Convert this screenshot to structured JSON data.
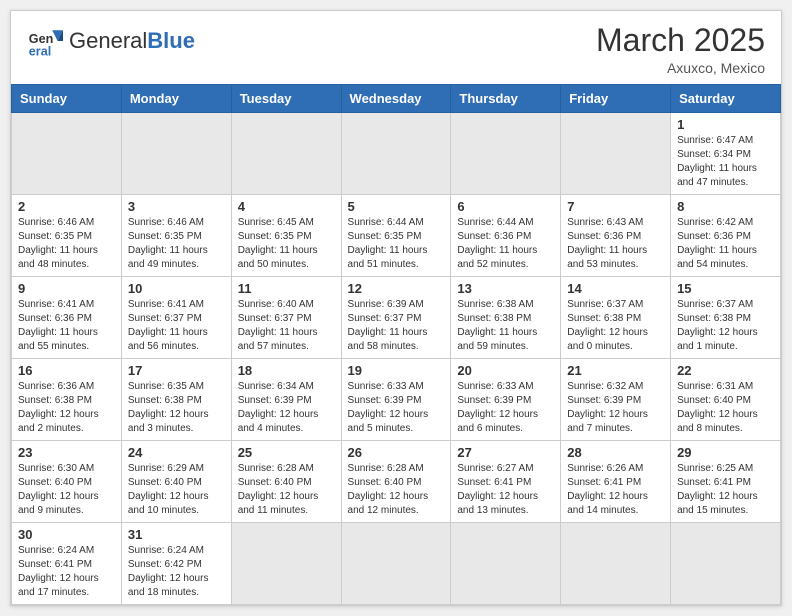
{
  "header": {
    "logo_general": "General",
    "logo_blue": "Blue",
    "month_year": "March 2025",
    "subtitle": "Axuxco, Mexico"
  },
  "days_of_week": [
    "Sunday",
    "Monday",
    "Tuesday",
    "Wednesday",
    "Thursday",
    "Friday",
    "Saturday"
  ],
  "weeks": [
    [
      {
        "day": "",
        "empty": true
      },
      {
        "day": "",
        "empty": true
      },
      {
        "day": "",
        "empty": true
      },
      {
        "day": "",
        "empty": true
      },
      {
        "day": "",
        "empty": true
      },
      {
        "day": "",
        "empty": true
      },
      {
        "day": "1",
        "sunrise": "6:47 AM",
        "sunset": "6:34 PM",
        "daylight": "11 hours and 47 minutes."
      }
    ],
    [
      {
        "day": "2",
        "sunrise": "6:46 AM",
        "sunset": "6:35 PM",
        "daylight": "11 hours and 48 minutes."
      },
      {
        "day": "3",
        "sunrise": "6:46 AM",
        "sunset": "6:35 PM",
        "daylight": "11 hours and 49 minutes."
      },
      {
        "day": "4",
        "sunrise": "6:45 AM",
        "sunset": "6:35 PM",
        "daylight": "11 hours and 50 minutes."
      },
      {
        "day": "5",
        "sunrise": "6:44 AM",
        "sunset": "6:35 PM",
        "daylight": "11 hours and 51 minutes."
      },
      {
        "day": "6",
        "sunrise": "6:44 AM",
        "sunset": "6:36 PM",
        "daylight": "11 hours and 52 minutes."
      },
      {
        "day": "7",
        "sunrise": "6:43 AM",
        "sunset": "6:36 PM",
        "daylight": "11 hours and 53 minutes."
      },
      {
        "day": "8",
        "sunrise": "6:42 AM",
        "sunset": "6:36 PM",
        "daylight": "11 hours and 54 minutes."
      }
    ],
    [
      {
        "day": "9",
        "sunrise": "6:41 AM",
        "sunset": "6:36 PM",
        "daylight": "11 hours and 55 minutes."
      },
      {
        "day": "10",
        "sunrise": "6:41 AM",
        "sunset": "6:37 PM",
        "daylight": "11 hours and 56 minutes."
      },
      {
        "day": "11",
        "sunrise": "6:40 AM",
        "sunset": "6:37 PM",
        "daylight": "11 hours and 57 minutes."
      },
      {
        "day": "12",
        "sunrise": "6:39 AM",
        "sunset": "6:37 PM",
        "daylight": "11 hours and 58 minutes."
      },
      {
        "day": "13",
        "sunrise": "6:38 AM",
        "sunset": "6:38 PM",
        "daylight": "11 hours and 59 minutes."
      },
      {
        "day": "14",
        "sunrise": "6:37 AM",
        "sunset": "6:38 PM",
        "daylight": "12 hours and 0 minutes."
      },
      {
        "day": "15",
        "sunrise": "6:37 AM",
        "sunset": "6:38 PM",
        "daylight": "12 hours and 1 minute."
      }
    ],
    [
      {
        "day": "16",
        "sunrise": "6:36 AM",
        "sunset": "6:38 PM",
        "daylight": "12 hours and 2 minutes."
      },
      {
        "day": "17",
        "sunrise": "6:35 AM",
        "sunset": "6:38 PM",
        "daylight": "12 hours and 3 minutes."
      },
      {
        "day": "18",
        "sunrise": "6:34 AM",
        "sunset": "6:39 PM",
        "daylight": "12 hours and 4 minutes."
      },
      {
        "day": "19",
        "sunrise": "6:33 AM",
        "sunset": "6:39 PM",
        "daylight": "12 hours and 5 minutes."
      },
      {
        "day": "20",
        "sunrise": "6:33 AM",
        "sunset": "6:39 PM",
        "daylight": "12 hours and 6 minutes."
      },
      {
        "day": "21",
        "sunrise": "6:32 AM",
        "sunset": "6:39 PM",
        "daylight": "12 hours and 7 minutes."
      },
      {
        "day": "22",
        "sunrise": "6:31 AM",
        "sunset": "6:40 PM",
        "daylight": "12 hours and 8 minutes."
      }
    ],
    [
      {
        "day": "23",
        "sunrise": "6:30 AM",
        "sunset": "6:40 PM",
        "daylight": "12 hours and 9 minutes."
      },
      {
        "day": "24",
        "sunrise": "6:29 AM",
        "sunset": "6:40 PM",
        "daylight": "12 hours and 10 minutes."
      },
      {
        "day": "25",
        "sunrise": "6:28 AM",
        "sunset": "6:40 PM",
        "daylight": "12 hours and 11 minutes."
      },
      {
        "day": "26",
        "sunrise": "6:28 AM",
        "sunset": "6:40 PM",
        "daylight": "12 hours and 12 minutes."
      },
      {
        "day": "27",
        "sunrise": "6:27 AM",
        "sunset": "6:41 PM",
        "daylight": "12 hours and 13 minutes."
      },
      {
        "day": "28",
        "sunrise": "6:26 AM",
        "sunset": "6:41 PM",
        "daylight": "12 hours and 14 minutes."
      },
      {
        "day": "29",
        "sunrise": "6:25 AM",
        "sunset": "6:41 PM",
        "daylight": "12 hours and 15 minutes."
      }
    ],
    [
      {
        "day": "30",
        "sunrise": "6:24 AM",
        "sunset": "6:41 PM",
        "daylight": "12 hours and 17 minutes."
      },
      {
        "day": "31",
        "sunrise": "6:24 AM",
        "sunset": "6:42 PM",
        "daylight": "12 hours and 18 minutes."
      },
      {
        "day": "",
        "empty": true
      },
      {
        "day": "",
        "empty": true
      },
      {
        "day": "",
        "empty": true
      },
      {
        "day": "",
        "empty": true
      },
      {
        "day": "",
        "empty": true
      }
    ]
  ]
}
